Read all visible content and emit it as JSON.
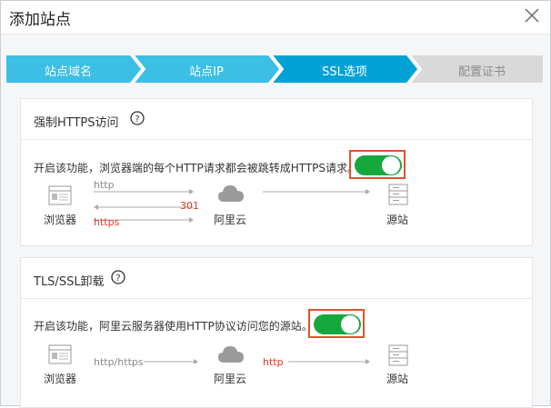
{
  "dialog": {
    "title": "添加站点"
  },
  "steps": [
    {
      "label": "站点域名",
      "state": "done"
    },
    {
      "label": "站点IP",
      "state": "done"
    },
    {
      "label": "SSL选项",
      "state": "active"
    },
    {
      "label": "配置证书",
      "state": "pending"
    }
  ],
  "https_section": {
    "title": "强制HTTPS访问",
    "description": "开启该功能，浏览器端的每个HTTP请求都会被跳转成HTTPS请求。",
    "enabled": true,
    "diagram": {
      "browser_label": "浏览器",
      "cloud_label": "阿里云",
      "origin_label": "源站",
      "http_label": "http",
      "redirect_label": "301",
      "https_label": "https"
    }
  },
  "tls_section": {
    "title": "TLS/SSL卸载",
    "description": "开启该功能，阿里云服务器使用HTTP协议访问您的源站。",
    "enabled": true,
    "diagram": {
      "browser_label": "浏览器",
      "cloud_label": "阿里云",
      "origin_label": "源站",
      "client_protocol_label": "http/https",
      "origin_protocol_label": "http"
    }
  },
  "colors": {
    "step_done": "#3bbfe4",
    "step_active": "#00a2d6",
    "step_pending": "#d9d9d9",
    "toggle_on": "#17a83d",
    "highlight": "#e0522e",
    "red_text": "#e53524"
  },
  "icons": [
    "close-icon",
    "help-icon",
    "browser-icon",
    "cloud-icon",
    "server-icon"
  ]
}
